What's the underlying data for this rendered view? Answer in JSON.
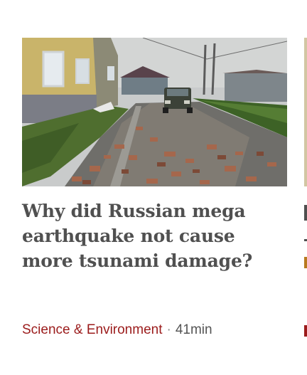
{
  "card": {
    "title": "Why did Russian mega earthquake not cause more tsunami damage?",
    "topic": "Science & Environment",
    "separator": "·",
    "read_time": "41min",
    "image_icon": "street-debris-photo"
  },
  "colors": {
    "title": "#505050",
    "topic": "#9b1b1b",
    "meta": "#545454"
  }
}
